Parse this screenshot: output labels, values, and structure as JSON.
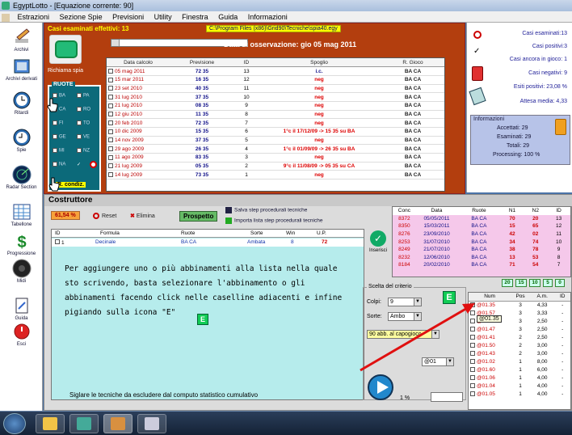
{
  "window": {
    "title": "EgyptLotto - [Equazione corrente: 90]"
  },
  "menu": [
    "Estrazioni",
    "Sezione Spie",
    "Previsioni",
    "Utility",
    "Finestra",
    "Guida",
    "Informazioni"
  ],
  "sidebar": {
    "items": [
      {
        "label": "Archivi",
        "icon": "pencil-icon"
      },
      {
        "label": "Archivi derivati",
        "icon": "book-icon"
      },
      {
        "label": "Ritardi",
        "icon": "clock-icon"
      },
      {
        "label": "Spie",
        "icon": "clock-icon"
      },
      {
        "label": "Radar Section",
        "icon": "radar-icon"
      },
      {
        "label": "Tabellone",
        "icon": "table-icon"
      },
      {
        "label": "Progressione",
        "icon": "dollar-icon"
      },
      {
        "label": "Midi",
        "icon": "speaker-icon"
      },
      {
        "label": "Guida",
        "icon": "guide-icon"
      },
      {
        "label": "Esci",
        "icon": "power-icon"
      }
    ]
  },
  "top": {
    "casi_label": "Casi esaminati effettivi: 13",
    "path": "C:\\Program Files (x86)\\Grid90\\Tecniche\\spia40.egy",
    "data_osservazione": "Data di osservazione:  gio 05 mag 2011",
    "richiama": "Richiama spia",
    "ruote_label": "RUOTE",
    "ruote": [
      {
        "name": "BA",
        "checked": true
      },
      {
        "name": "PA",
        "checked": false
      },
      {
        "name": "CA",
        "checked": true
      },
      {
        "name": "RO",
        "checked": false
      },
      {
        "name": "FI",
        "checked": false
      },
      {
        "name": "TO",
        "checked": false
      },
      {
        "name": "GE",
        "checked": false
      },
      {
        "name": "VE",
        "checked": false
      },
      {
        "name": "MI",
        "checked": false
      },
      {
        "name": "NZ",
        "checked": false
      },
      {
        "name": "NA",
        "checked": false
      },
      {
        "name": "✓",
        "checked": false
      }
    ],
    "rcondiz": "R. condiz.",
    "headers": [
      "Data calcolo",
      "Previsione",
      "ID",
      "Spoglio",
      "R. Gioco"
    ],
    "rows": [
      [
        "05 mag 2011",
        "72 35",
        "13",
        "i.c.",
        "BA CA"
      ],
      [
        "15 mar 2011",
        "16 35",
        "12",
        "neg",
        "BA CA"
      ],
      [
        "23 set 2010",
        "40 35",
        "11",
        "neg",
        "BA CA"
      ],
      [
        "31 lug 2010",
        "37 35",
        "10",
        "neg",
        "BA CA"
      ],
      [
        "21 lug 2010",
        "08 35",
        "9",
        "neg",
        "BA CA"
      ],
      [
        "12 giu 2010",
        "11 35",
        "8",
        "neg",
        "BA CA"
      ],
      [
        "20 feb 2010",
        "72 35",
        "7",
        "neg",
        "BA CA"
      ],
      [
        "10 dic 2009",
        "15 35",
        "6",
        "1°c il 17/12/09 -> 15 35 su BA",
        "BA CA"
      ],
      [
        "14 nov 2009",
        "37 35",
        "5",
        "neg",
        "BA CA"
      ],
      [
        "29 ago 2009",
        "26 35",
        "4",
        "1°c il 01/09/09 -> 26 35 su BA",
        "BA CA"
      ],
      [
        "11 ago 2009",
        "83 35",
        "3",
        "neg",
        "BA CA"
      ],
      [
        "21 lug 2009",
        "05 35",
        "2",
        "9°c il 11/08/09 -> 05 35 su CA",
        "BA CA"
      ],
      [
        "14 lug 2009",
        "73 35",
        "1",
        "neg",
        "BA CA"
      ]
    ]
  },
  "stats": {
    "casi_esaminati": "Casi esaminati:13",
    "casi_positivi": "Casi positivi:3",
    "casi_ancora": "Casi ancora in gioco: 1",
    "casi_negativi": "Casi negativi: 9",
    "esiti_positivi": "Esiti positivi: 23,08 %",
    "attesa_media": "Attesa media: 4,33"
  },
  "info": {
    "label": "Informazioni",
    "accettati": "Accettati:  29",
    "esaminati": "Esaminati:  29",
    "totali": "Totali:  29",
    "processing": "Processing:  100 %"
  },
  "costruttore": {
    "label": "Costruttore",
    "pct": "61,54 %",
    "reset": "Reset",
    "elimina": "Elimina",
    "prospetto": "Prospetto",
    "salva": "Salva step procedurali tecniche",
    "importa": "Importa lista step procedurali tecniche",
    "headers": [
      "ID",
      "Formula",
      "Ruote",
      "Sorte",
      "Win",
      "U.P."
    ],
    "row": [
      "1",
      "Decinale",
      "BA CA",
      "Ambata",
      "8",
      "72"
    ],
    "note": "Per aggiungere uno o più abbinamenti alla lista nella quale sto scrivendo, basta selezionare l'abbinamento o gli abbinamenti facendo click nelle caselline adiacenti e infine pigiando sulla icona \"E\"",
    "e_label": "E",
    "siglare": "Siglare le tecniche da escludere dal computo statistico cumulativo",
    "inserisci": "Inserisci",
    "conc_headers": [
      "Conc",
      "Data",
      "Ruote",
      "N1",
      "N2",
      "ID"
    ],
    "conc_rows": [
      [
        "8372",
        "05/05/2011",
        "BA CA",
        "70",
        "20",
        "13"
      ],
      [
        "8350",
        "15/03/2011",
        "BA CA",
        "15",
        "65",
        "12"
      ],
      [
        "8276",
        "23/09/2010",
        "BA CA",
        "42",
        "02",
        "11"
      ],
      [
        "8253",
        "31/07/2010",
        "BA CA",
        "34",
        "74",
        "10"
      ],
      [
        "8249",
        "21/07/2010",
        "BA CA",
        "38",
        "78",
        "9"
      ],
      [
        "8232",
        "12/06/2010",
        "BA CA",
        "13",
        "53",
        "8"
      ],
      [
        "8184",
        "20/02/2010",
        "BA CA",
        "71",
        "54",
        "7"
      ]
    ],
    "mini": [
      "20",
      "15",
      "10",
      "5",
      "0"
    ],
    "criterio_label": "Scelta del criterio",
    "colpi_label": "Colpi:",
    "colpi_value": "9",
    "sorte_label": "Sorte:",
    "sorte_value": "Ambo",
    "capogioco": "90 abb. al capogioco",
    "at01": "@01",
    "pct1": "1 %",
    "num_headers": [
      "Num",
      "Pos",
      "A.m.",
      "ID"
    ],
    "num_rows": [
      [
        "@01.35",
        "3",
        "4,33",
        "-"
      ],
      [
        "@01.57",
        "3",
        "3,33",
        "-"
      ],
      [
        "@01.40",
        "3",
        "2,50",
        "-"
      ],
      [
        "@01.47",
        "3",
        "2,50",
        "-"
      ],
      [
        "@01.41",
        "2",
        "2,50",
        "-"
      ],
      [
        "@01.50",
        "2",
        "3,00",
        "-"
      ],
      [
        "@01.43",
        "2",
        "3,00",
        "-"
      ],
      [
        "@01.02",
        "1",
        "8,00",
        "-"
      ],
      [
        "@01.60",
        "1",
        "6,00",
        "-"
      ],
      [
        "@01.06",
        "1",
        "4,00",
        "-"
      ],
      [
        "@01.04",
        "1",
        "4,00",
        "-"
      ],
      [
        "@01.05",
        "1",
        "4,00",
        "-"
      ]
    ],
    "tooltip": "@01.35"
  },
  "colors": {
    "accent": "#b33e0e",
    "panel": "#b6ecec",
    "conc": "#f5c8ea"
  }
}
